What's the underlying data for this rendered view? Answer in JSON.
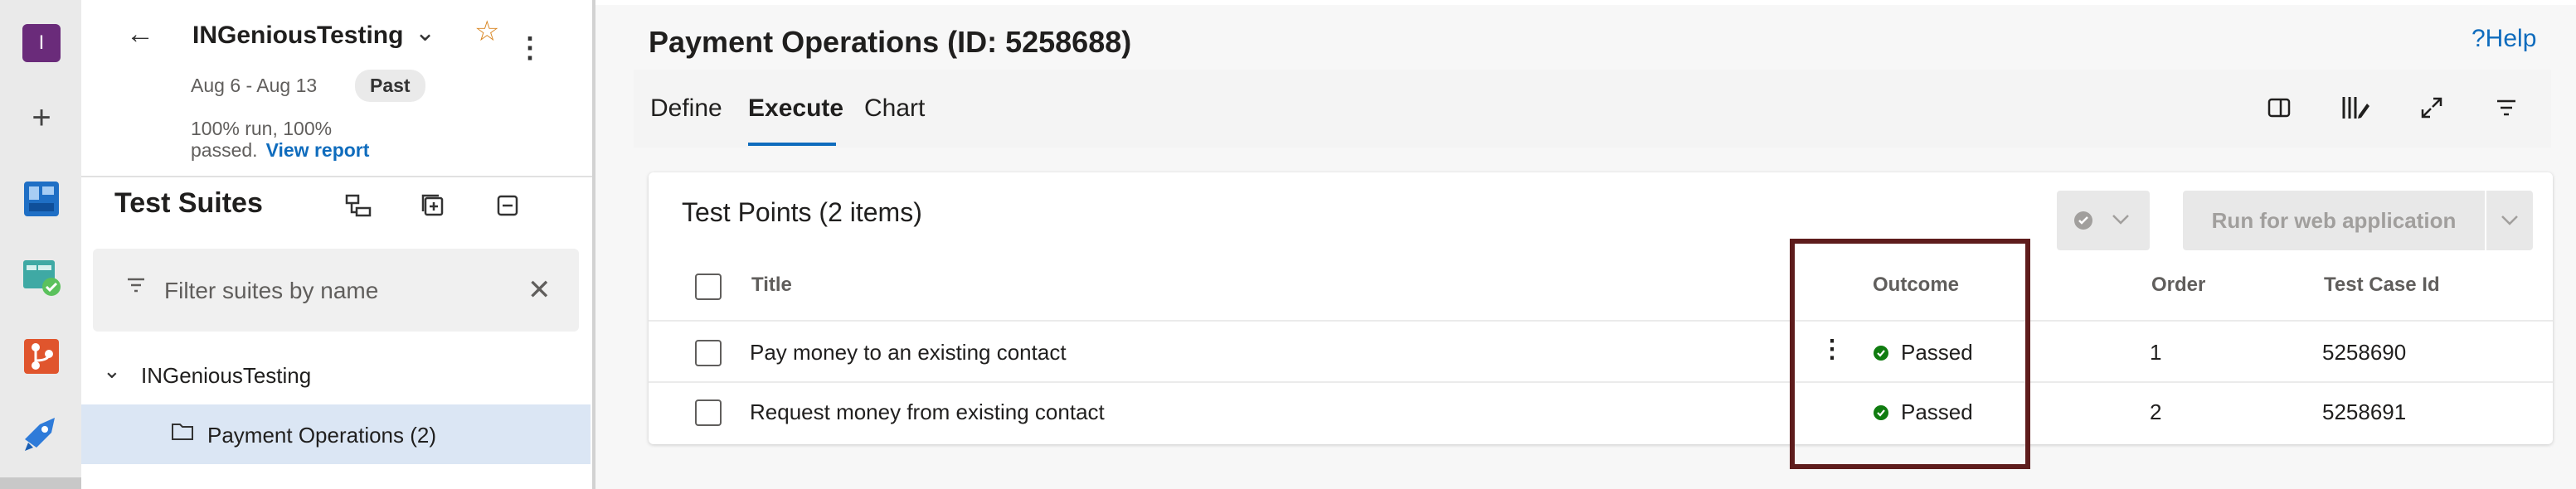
{
  "app": {
    "avatar_letter": "I",
    "rail_icons": [
      "plus-icon",
      "boards-icon",
      "test-plans-icon",
      "repos-icon",
      "pipelines-icon"
    ]
  },
  "plan": {
    "name": "INGeniousTesting",
    "date_range": "Aug 6 - Aug 13",
    "status_badge": "Past",
    "stats_line1": "100% run, 100%",
    "stats_line2": "passed.",
    "view_report": "View report"
  },
  "suites": {
    "title": "Test Suites",
    "filter_placeholder": "Filter suites by name",
    "tree": {
      "root": "INGeniousTesting",
      "child": "Payment Operations (2)"
    }
  },
  "main": {
    "title": "Payment Operations (ID: 5258688)",
    "help": "?Help",
    "tabs": [
      "Define",
      "Execute",
      "Chart"
    ],
    "active_tab": "Execute"
  },
  "test_points": {
    "title": "Test Points (2 items)",
    "run_button": "Run for web application",
    "columns": [
      "Title",
      "Outcome",
      "Order",
      "Test Case Id"
    ],
    "rows": [
      {
        "title": "Pay money to an existing contact",
        "outcome": "Passed",
        "order": "1",
        "test_case_id": "5258690"
      },
      {
        "title": "Request money from existing contact",
        "outcome": "Passed",
        "order": "2",
        "test_case_id": "5258691"
      }
    ]
  },
  "colors": {
    "accent": "#0f6cbd",
    "passed": "#107c10",
    "highlight": "#5e1c1c",
    "avatar": "#6a2b7a"
  }
}
